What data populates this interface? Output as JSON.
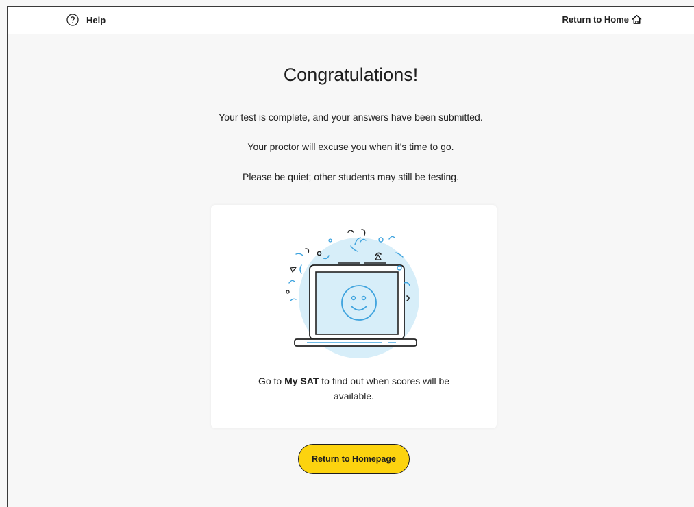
{
  "header": {
    "help_label": "Help",
    "return_home_label": "Return to Home"
  },
  "main": {
    "title": "Congratulations!",
    "messages": [
      "Your test is complete, and your answers have been submitted.",
      "Your proctor will excuse you when it’s time to go.",
      "Please be quiet; other students may still be testing."
    ],
    "card": {
      "text_before": "Go to ",
      "text_bold": "My SAT",
      "text_after": " to find out when scores will be available."
    },
    "cta_label": "Return to Homepage"
  },
  "icons": {
    "help": "question-circle-icon",
    "home": "home-icon",
    "illustration": "laptop-smiley-confetti"
  },
  "colors": {
    "background": "#f7f7f7",
    "card": "#ffffff",
    "accent_yellow": "#fcd30f",
    "illustration_blue": "#3ea3de",
    "illustration_circle": "#d7eef9"
  }
}
